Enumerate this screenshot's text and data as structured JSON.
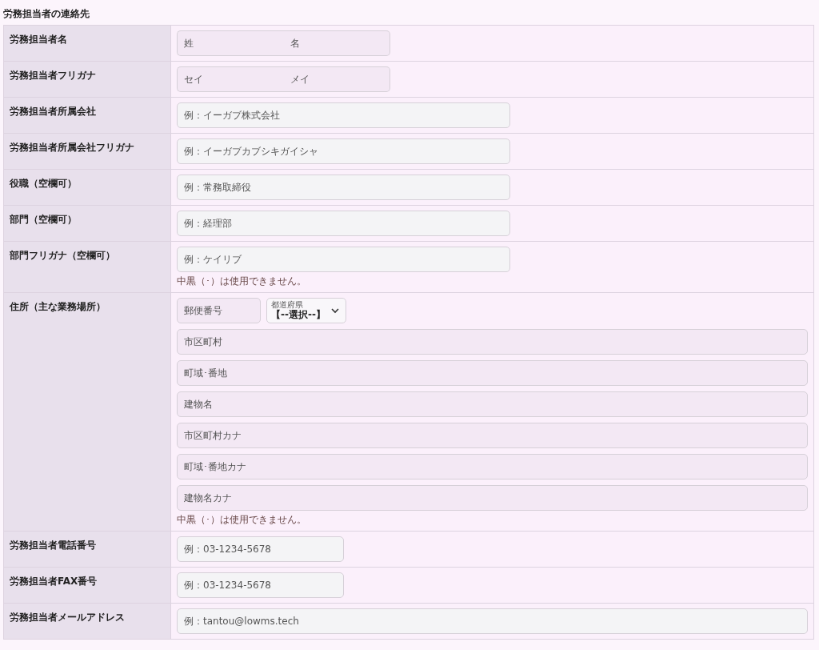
{
  "section_title": "労務担当者の連絡先",
  "rows": [
    {
      "label": "労務担当者名",
      "fields": [
        {
          "kind": "pair",
          "placeholders": [
            "姓",
            "名"
          ]
        }
      ]
    },
    {
      "label": "労務担当者フリガナ",
      "fields": [
        {
          "kind": "pair",
          "placeholders": [
            "セイ",
            "メイ"
          ]
        }
      ]
    },
    {
      "label": "労務担当者所属会社",
      "fields": [
        {
          "kind": "medium",
          "placeholder": "例：イーガブ株式会社"
        }
      ]
    },
    {
      "label": "労務担当者所属会社フリガナ",
      "fields": [
        {
          "kind": "medium",
          "placeholder": "例：イーガブカブシキガイシャ"
        }
      ]
    },
    {
      "label": "役職（空欄可）",
      "fields": [
        {
          "kind": "medium",
          "placeholder": "例：常務取締役"
        }
      ]
    },
    {
      "label": "部門（空欄可）",
      "fields": [
        {
          "kind": "medium",
          "placeholder": "例：経理部"
        }
      ]
    },
    {
      "label": "部門フリガナ（空欄可）",
      "fields": [
        {
          "kind": "medium",
          "placeholder": "例：ケイリブ"
        }
      ],
      "note": "中黒（･）は使用できません。"
    },
    {
      "label": "住所（主な業務場所）",
      "fields": [
        {
          "kind": "postal",
          "placeholder": "郵便番号"
        },
        {
          "kind": "select",
          "label": "都道府県",
          "value": "【--選択--】"
        },
        {
          "kind": "address",
          "placeholder": "市区町村"
        },
        {
          "kind": "address",
          "placeholder": "町域･番地"
        },
        {
          "kind": "address",
          "placeholder": "建物名"
        },
        {
          "kind": "address",
          "placeholder": "市区町村カナ"
        },
        {
          "kind": "address",
          "placeholder": "町域･番地カナ"
        },
        {
          "kind": "address",
          "placeholder": "建物名カナ"
        }
      ],
      "note": "中黒（･）は使用できません。"
    },
    {
      "label": "労務担当者電話番号",
      "fields": [
        {
          "kind": "short",
          "placeholder": "例：03-1234-5678"
        }
      ]
    },
    {
      "label": "労務担当者FAX番号",
      "fields": [
        {
          "kind": "short",
          "placeholder": "例：03-1234-5678"
        }
      ]
    },
    {
      "label": "労務担当者メールアドレス",
      "fields": [
        {
          "kind": "wide",
          "placeholder": "例：tantou@lowms.tech"
        }
      ]
    }
  ]
}
